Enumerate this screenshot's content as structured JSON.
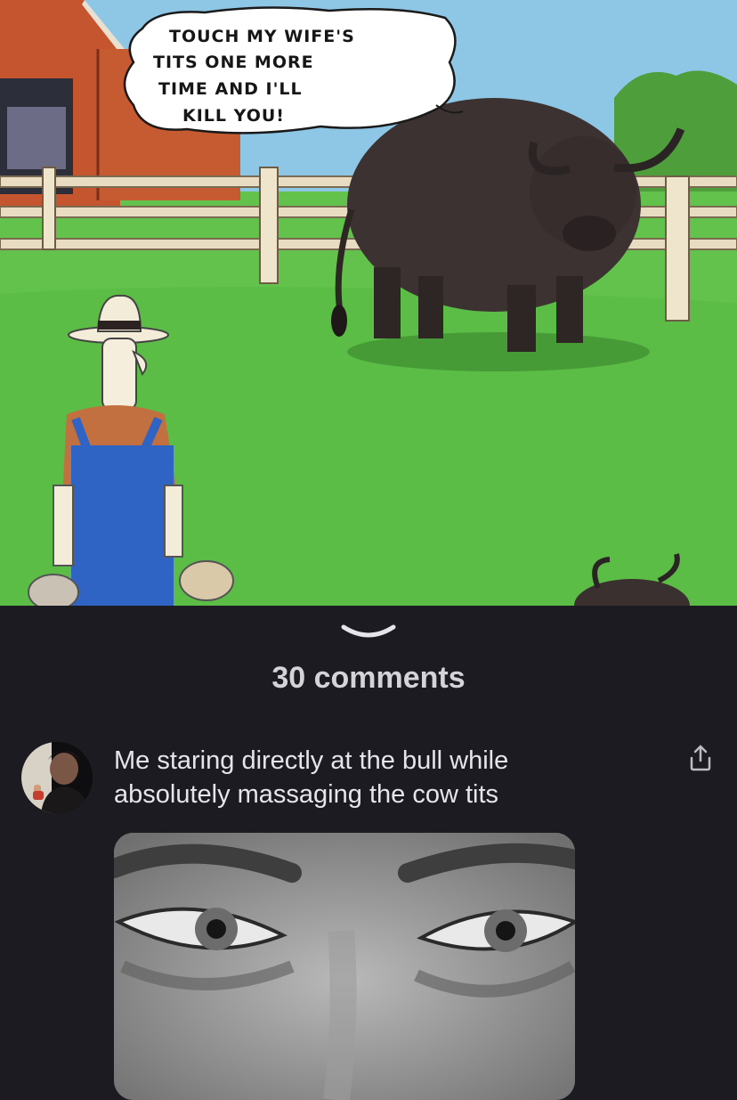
{
  "post": {
    "image": {
      "speech_bubble_lines": [
        "TOUCH MY WIFE'S",
        "TITS ONE MORE",
        "TIME AND I'LL",
        "KILL YOU!"
      ]
    }
  },
  "comments_section": {
    "collapse_icon": "chevron-down-icon",
    "count_label": "30 comments"
  },
  "comment": {
    "avatar_icon": "user-avatar",
    "text": "Me staring directly at the bull while absolutely massaging the cow tits",
    "share_icon": "share-icon"
  },
  "colors": {
    "background": "#1c1b21",
    "text_primary": "#e6e5ea",
    "text_secondary": "#d4d3d8"
  }
}
